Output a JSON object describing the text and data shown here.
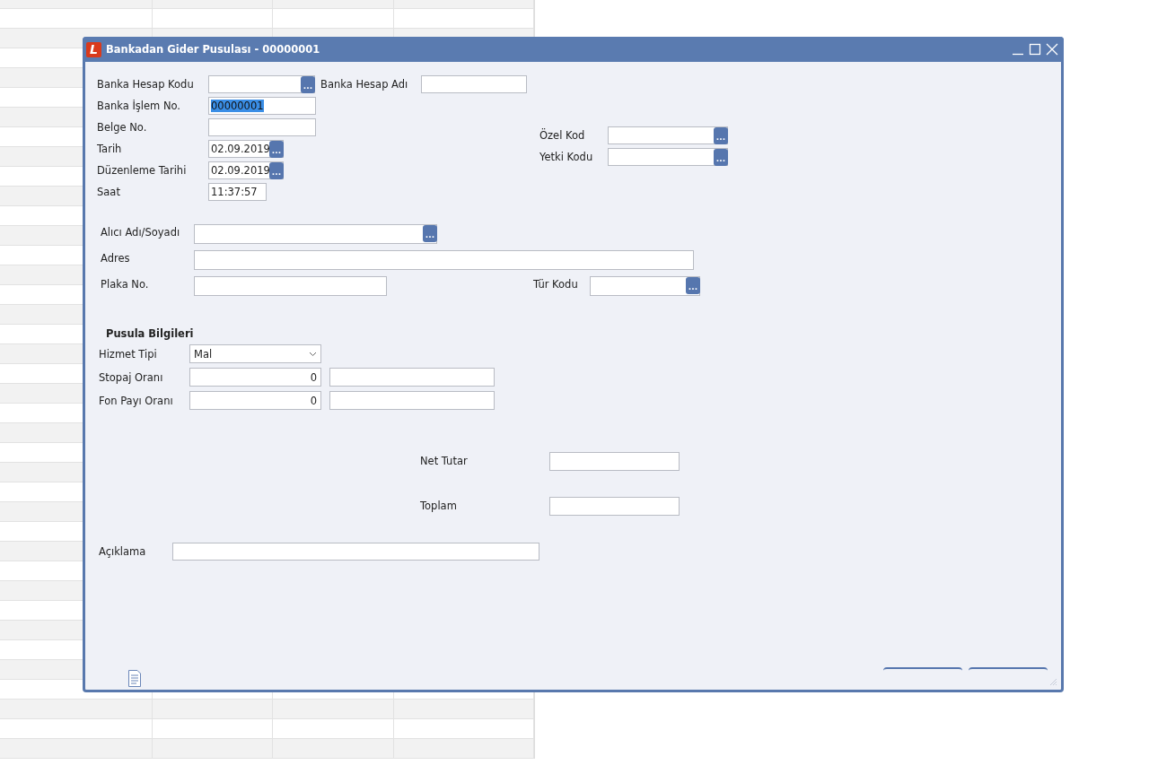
{
  "window": {
    "logo": "L",
    "title": "Bankadan Gider Pusulası - 00000001"
  },
  "header": {
    "banka_hesap_kodu": {
      "label": "Banka Hesap Kodu",
      "button": "..."
    },
    "banka_hesap_adi": {
      "label": "Banka Hesap Adı"
    },
    "banka_islem_no": {
      "label": "Banka İşlem No.",
      "value": "00000001",
      "value_selected": true
    },
    "belge_no": {
      "label": "Belge No."
    },
    "tarih": {
      "label": "Tarih",
      "value": "02.09.2019",
      "button": "..."
    },
    "duzenleme_tarihi": {
      "label": "Düzenleme Tarihi",
      "value": "02.09.2019",
      "button": "..."
    },
    "saat": {
      "label": "Saat",
      "value": "11:37:57"
    },
    "ozel_kod": {
      "label": "Özel Kod",
      "button": "..."
    },
    "yetki_kodu": {
      "label": "Yetki Kodu",
      "button": "..."
    }
  },
  "recipient": {
    "alici": {
      "label": "Alıcı Adı/Soyadı",
      "button": "..."
    },
    "adres": {
      "label": "Adres"
    },
    "plaka_no": {
      "label": "Plaka No."
    },
    "tur_kodu": {
      "label": "Tür Kodu",
      "button": "..."
    }
  },
  "pusula": {
    "title": "Pusula Bilgileri",
    "hizmet_tipi": {
      "label": "Hizmet Tipi",
      "value": "Mal"
    },
    "stopaj_orani": {
      "label": "Stopaj Oranı",
      "value": "0"
    },
    "fon_payi_orani": {
      "label": "Fon Payı Oranı",
      "value": "0"
    }
  },
  "totals": {
    "net_tutar": {
      "label": "Net Tutar"
    },
    "toplam": {
      "label": "Toplam"
    }
  },
  "aciklama": {
    "label": "Açıklama"
  }
}
